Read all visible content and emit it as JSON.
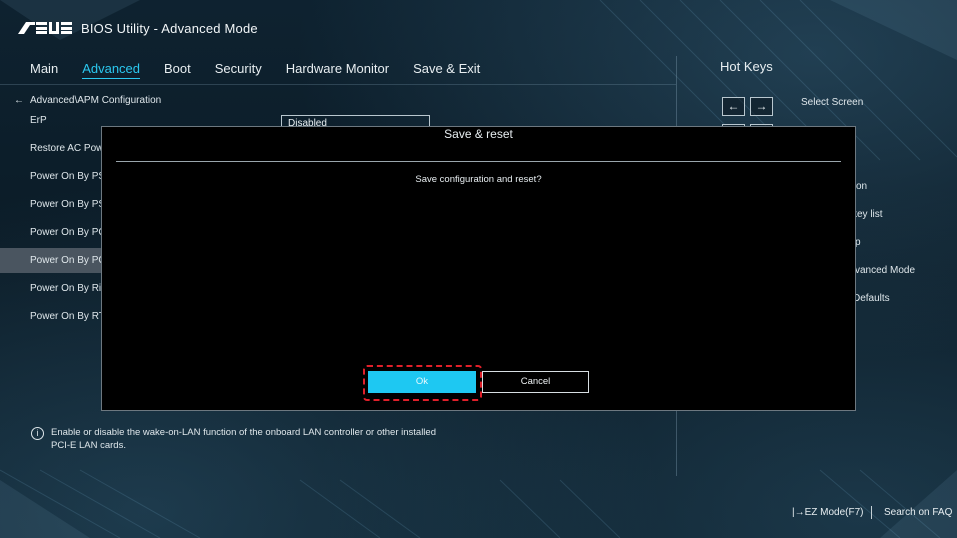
{
  "app": {
    "brand": "ASUS",
    "title": "BIOS Utility - Advanced Mode"
  },
  "nav": {
    "tabs": [
      {
        "label": "Main",
        "active": false
      },
      {
        "label": "Advanced",
        "active": true
      },
      {
        "label": "Boot",
        "active": false
      },
      {
        "label": "Security",
        "active": false
      },
      {
        "label": "Hardware Monitor",
        "active": false
      },
      {
        "label": "Save & Exit",
        "active": false
      }
    ]
  },
  "breadcrumb": {
    "arrow": "←",
    "path": "Advanced\\APM Configuration"
  },
  "settings": {
    "items": [
      {
        "label": "ErP"
      },
      {
        "label": "Restore AC Powe"
      },
      {
        "label": "Power On By PS/"
      },
      {
        "label": "Power On By PS/"
      },
      {
        "label": "Power On By PCI"
      },
      {
        "label": "Power On By PCI"
      },
      {
        "label": "Power On By Rin"
      },
      {
        "label": "Power On By RTC"
      }
    ],
    "selected_index": 5,
    "erp_value": "Disabled"
  },
  "hotkeys": {
    "title": "Hot Keys",
    "key_left": "←",
    "key_right": "→",
    "items": [
      {
        "label": "Select Screen"
      },
      {
        "label": "on"
      },
      {
        "label": "key list"
      },
      {
        "label": "p"
      },
      {
        "label": "vanced Mode"
      },
      {
        "label": "Defaults"
      }
    ]
  },
  "dialog": {
    "title": "Save & reset",
    "message": "Save configuration and reset?",
    "ok_label": "Ok",
    "cancel_label": "Cancel"
  },
  "help": {
    "icon_glyph": "i",
    "text": "Enable or disable the wake-on-LAN function of the onboard LAN controller or other installed PCI-E LAN cards."
  },
  "footer": {
    "ez_mode": "EZ Mode(F7)",
    "search_faq": "Search on FAQ"
  },
  "colors": {
    "accent": "#2bc8f0",
    "ok_button": "#1ec8f2",
    "highlight": "#e0202a",
    "dialog_bg": "#000000"
  }
}
